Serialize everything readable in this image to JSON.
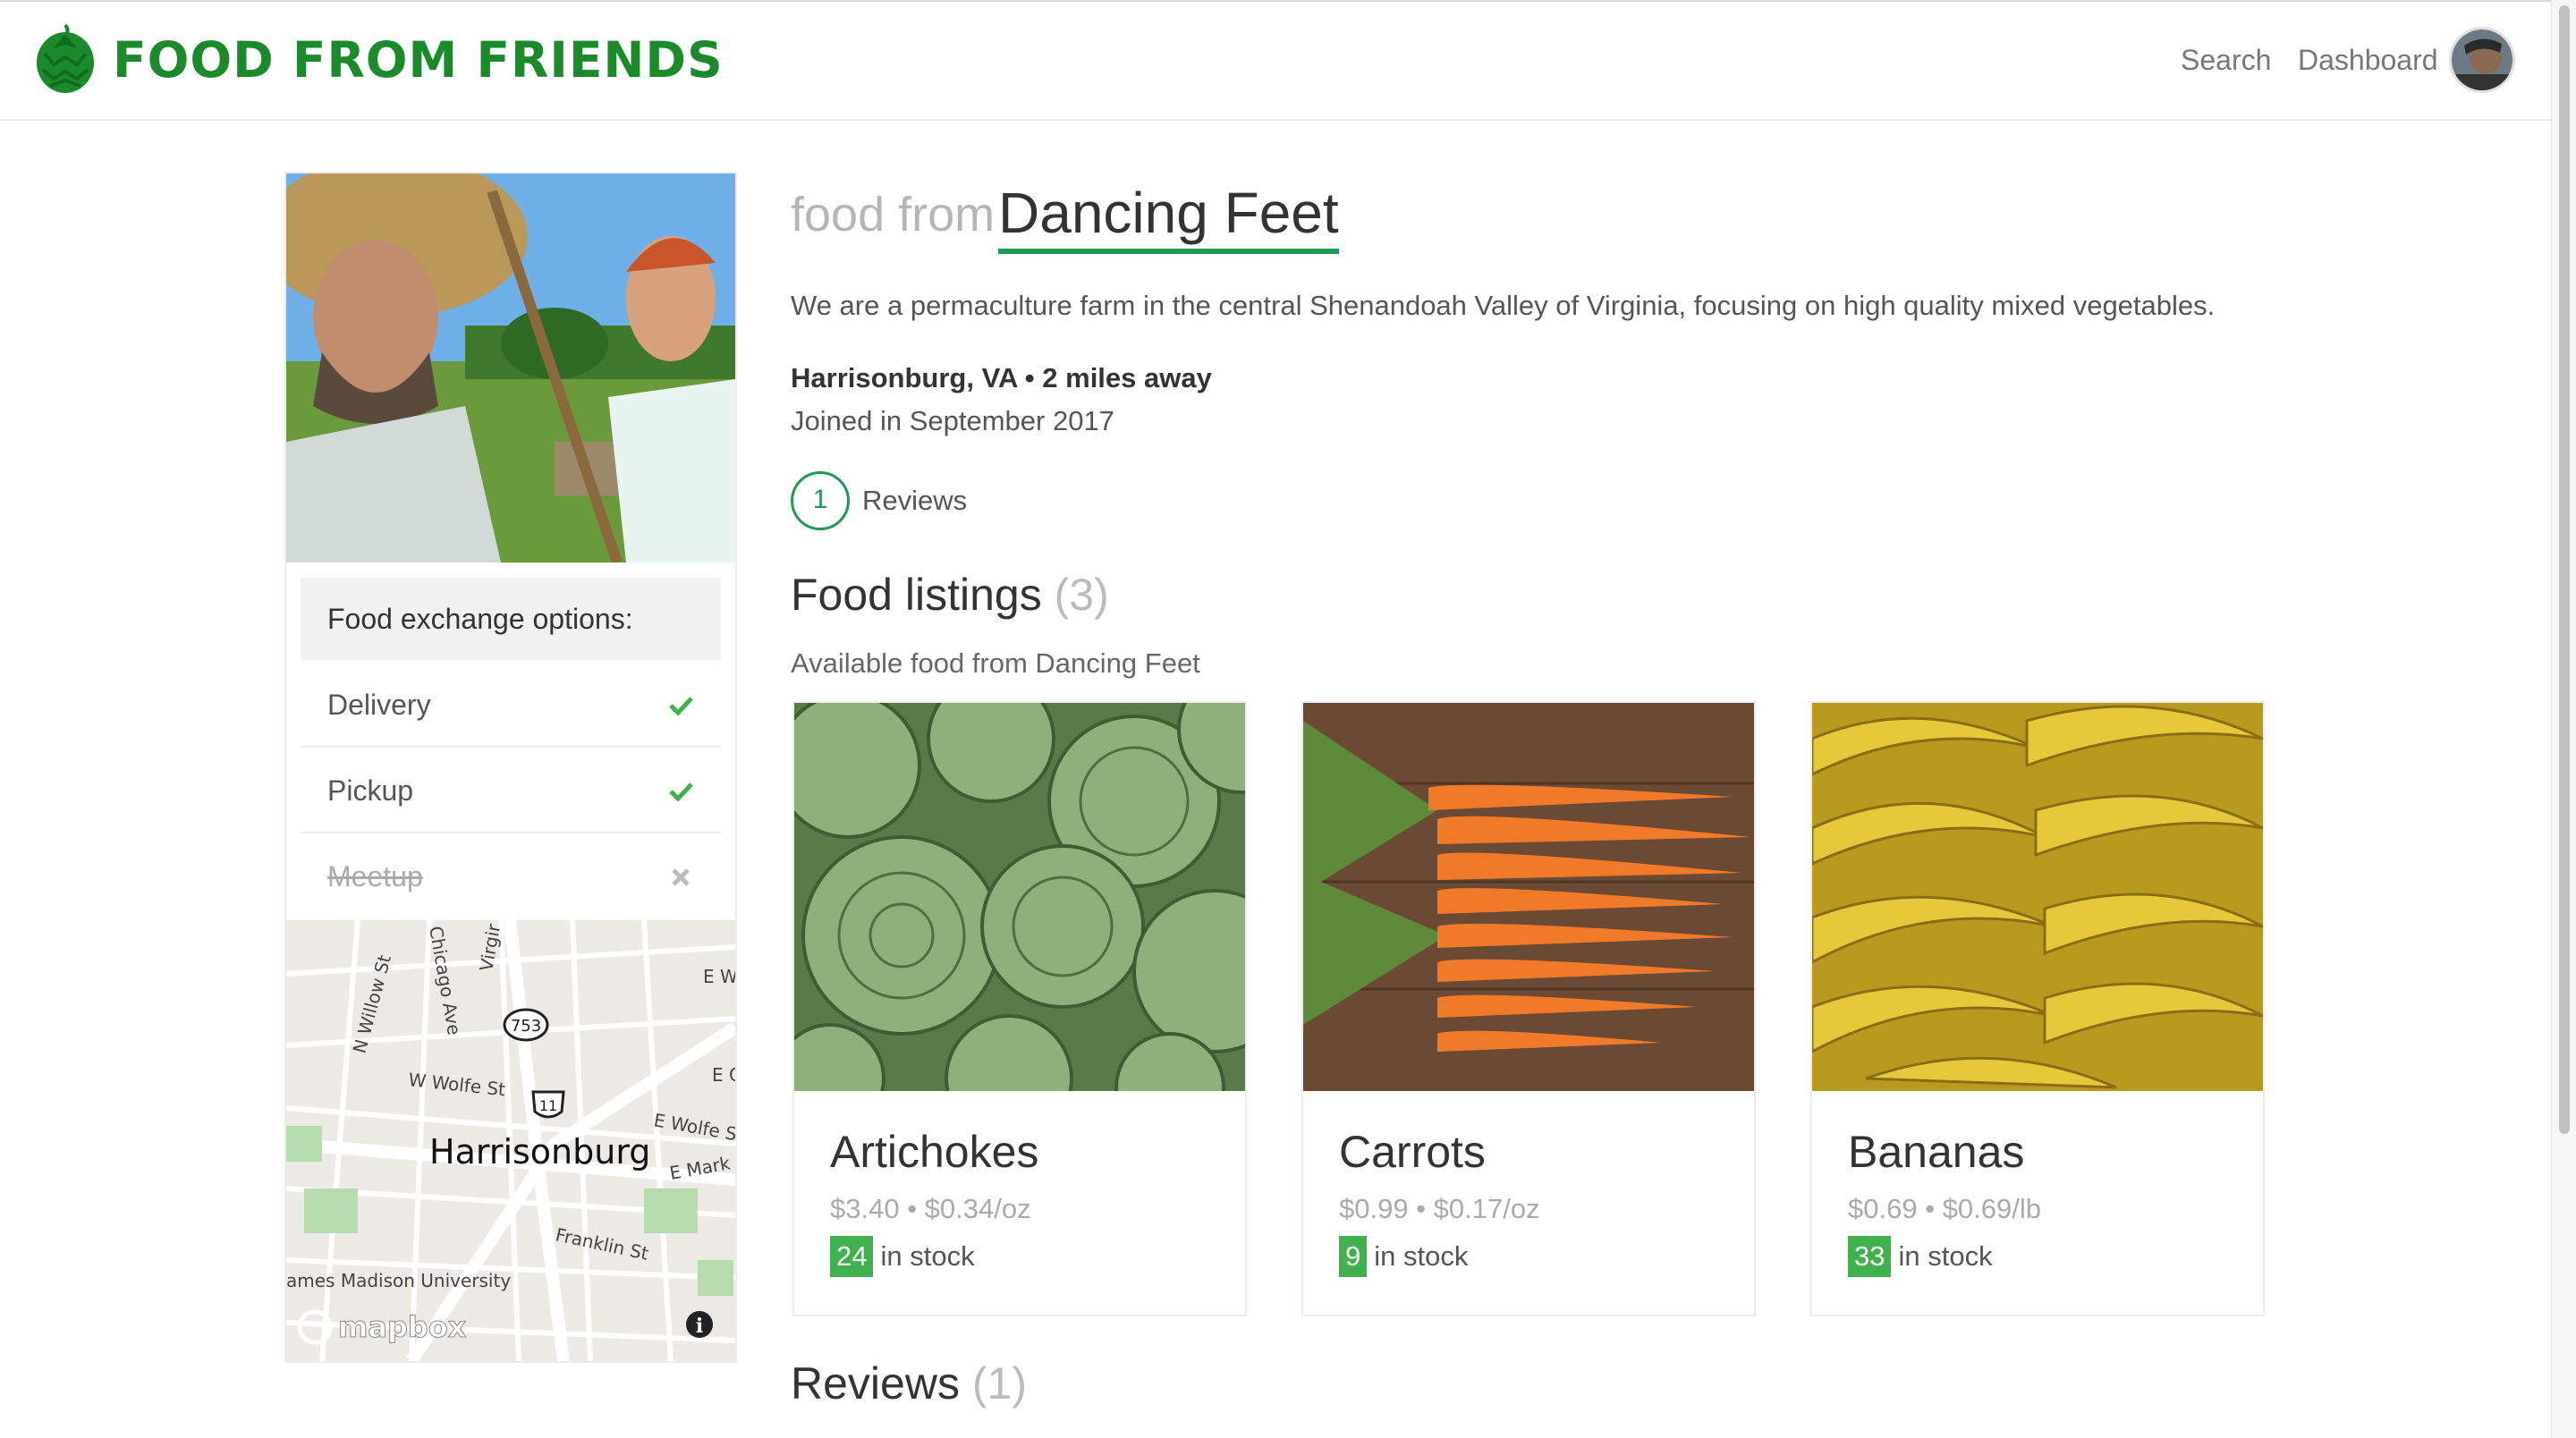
{
  "header": {
    "brand": "FOOD FROM FRIENDS",
    "nav": {
      "search": "Search",
      "dashboard": "Dashboard"
    }
  },
  "sidebar": {
    "exchange_title": "Food exchange options:",
    "options": [
      {
        "label": "Delivery",
        "available": true,
        "icon": "check-icon"
      },
      {
        "label": "Pickup",
        "available": true,
        "icon": "check-icon"
      },
      {
        "label": "Meetup",
        "available": false,
        "icon": "x-icon"
      }
    ],
    "map": {
      "city": "Harrisonburg",
      "streets": [
        "N Willow St",
        "Chicago Ave",
        "Virgir",
        "W Wolfe St",
        "E Wolfe S",
        "E Mark",
        "Franklin St",
        "E W",
        "E G"
      ],
      "route_shields": [
        "753",
        "11"
      ],
      "poi": "ames Madison University",
      "attribution": "mapbox"
    }
  },
  "farm": {
    "pre_title": "food from",
    "name": "Dancing Feet",
    "description": "We are a permaculture farm in the central Shenandoah Valley of Virginia, focusing on high quality mixed vegetables.",
    "location": "Harrisonburg, VA • 2 miles away",
    "joined": "Joined in September 2017",
    "review_count": "1",
    "reviews_label": "Reviews"
  },
  "listings": {
    "title": "Food listings",
    "count": "(3)",
    "subtitle": "Available food from Dancing Feet",
    "items": [
      {
        "name": "Artichokes",
        "price": "$3.40 • $0.34/oz",
        "stock": "24",
        "stock_label": "in stock"
      },
      {
        "name": "Carrots",
        "price": "$0.99 • $0.17/oz",
        "stock": "9",
        "stock_label": "in stock"
      },
      {
        "name": "Bananas",
        "price": "$0.69 • $0.69/lb",
        "stock": "33",
        "stock_label": "in stock"
      }
    ]
  },
  "reviews_section": {
    "title": "Reviews",
    "count": "(1)"
  },
  "colors": {
    "brand_green": "#1a8a2a",
    "accent": "#1f9a55",
    "stock_badge": "#3fb24d"
  }
}
